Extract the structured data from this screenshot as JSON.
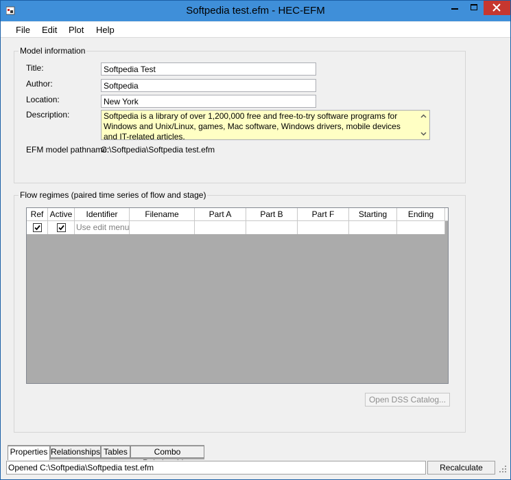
{
  "window": {
    "title": "Softpedia test.efm - HEC-EFM"
  },
  "menu": {
    "items": [
      "File",
      "Edit",
      "Plot",
      "Help"
    ]
  },
  "model_info": {
    "legend": "Model information",
    "title_label": "Title:",
    "title_value": "Softpedia Test",
    "author_label": "Author:",
    "author_value": "Softpedia",
    "location_label": "Location:",
    "location_value": "New York",
    "description_label": "Description:",
    "description_value": "Softpedia is a library of over 1,200,000 free and free-to-try software programs for Windows and Unix/Linux, games, Mac software, Windows drivers, mobile devices and IT-related articles.",
    "pathname_label": "EFM model pathname:",
    "pathname_value": "C:\\Softpedia\\Softpedia test.efm"
  },
  "flow_regimes": {
    "legend": "Flow regimes (paired time series of flow and stage)",
    "columns": [
      "Ref",
      "Active",
      "Identifier",
      "Filename",
      "Part A",
      "Part B",
      "Part F",
      "Starting",
      "Ending"
    ],
    "rows": [
      {
        "ref": true,
        "active": true,
        "identifier": "Use edit menu t",
        "filename": "",
        "part_a": "",
        "part_b": "",
        "part_f": "",
        "starting": "",
        "ending": ""
      }
    ],
    "open_dss_catalog_label": "Open DSS Catalog..."
  },
  "tabs": [
    "Properties",
    "Relationships",
    "Tables",
    "Combo Relationships"
  ],
  "active_tab": "Properties",
  "status": {
    "text": "Opened C:\\Softpedia\\Softpedia test.efm",
    "recalculate_label": "Recalculate"
  },
  "colors": {
    "titlebar": "#3f8fd9",
    "close_button": "#c7372f",
    "description_bg": "#ffffc4",
    "grid_empty": "#ababab"
  },
  "icons": [
    "app-icon",
    "minimize-icon",
    "maximize-icon",
    "close-icon",
    "scroll-up-icon",
    "scroll-down-icon",
    "checkbox-checked-icon",
    "size-grip-icon"
  ]
}
